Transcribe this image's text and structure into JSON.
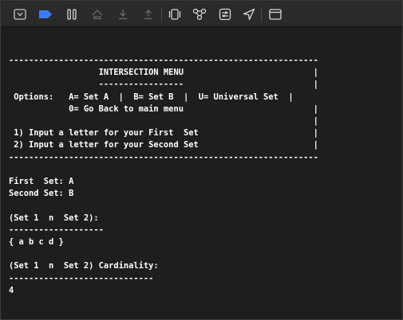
{
  "toolbar": {
    "icons": [
      "hide-debug-area-icon",
      "breakpoints-toggle-icon",
      "pause-icon",
      "step-over-icon",
      "step-into-icon",
      "step-out-icon",
      "view-debugger-icon",
      "memory-graph-icon",
      "environment-overrides-icon",
      "simulate-location-icon",
      "console-layout-icon"
    ],
    "accent_color": "#3d7bfd"
  },
  "console": {
    "lines": [
      "--------------------------------------------------------------",
      "                  INTERSECTION MENU                          |",
      "                  -----------------                          |",
      " Options:   A= Set A  |  B= Set B  |  U= Universal Set  |",
      "            0= Go Back to main menu                          |",
      "                                                             |",
      " 1) Input a letter for your First  Set                       |",
      " 2) Input a letter for your Second Set                       |",
      "--------------------------------------------------------------",
      "",
      "First  Set: A",
      "Second Set: B",
      "",
      "(Set 1  n  Set 2):",
      "-------------------",
      "{ a b c d }",
      "",
      "(Set 1  n  Set 2) Cardinality:",
      "-----------------------------",
      "4"
    ]
  }
}
